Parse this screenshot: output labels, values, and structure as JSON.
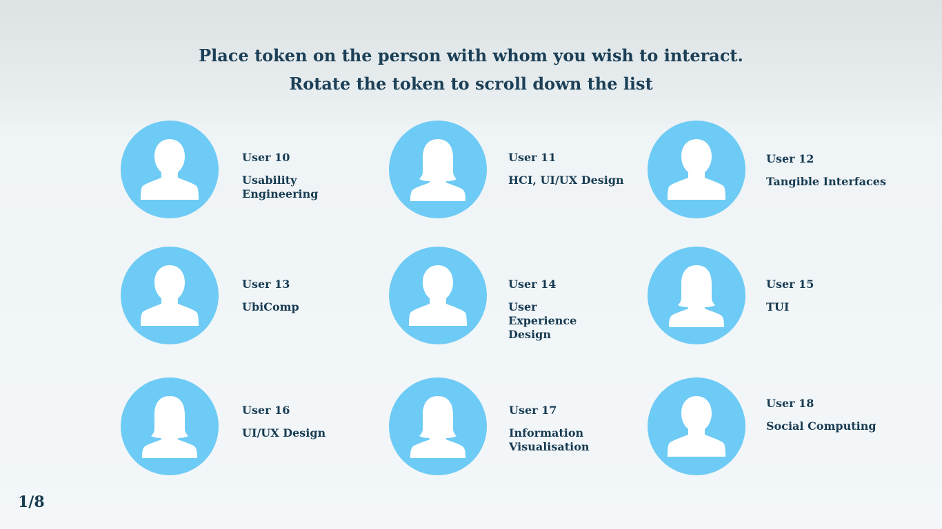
{
  "instructions": {
    "line1": "Place token on the person with whom you wish to interact.",
    "line2": "Rotate the token to scroll down the list"
  },
  "colors": {
    "avatar_circle": "#6ecbf5",
    "avatar_silhouette": "#ffffff",
    "text": "#173b52"
  },
  "users": [
    {
      "name": "User 10",
      "topic": "Usability Engineering",
      "avatar": "male-avatar-icon"
    },
    {
      "name": "User 11",
      "topic": "HCI, UI/UX Design",
      "avatar": "female-avatar-icon"
    },
    {
      "name": "User 12",
      "topic": "Tangible Interfaces",
      "avatar": "male-avatar-icon"
    },
    {
      "name": "User 13",
      "topic": "UbiComp",
      "avatar": "male-avatar-icon"
    },
    {
      "name": "User 14",
      "topic": "User Experience Design",
      "avatar": "male-avatar-icon"
    },
    {
      "name": "User 15",
      "topic": "TUI",
      "avatar": "female-avatar-icon"
    },
    {
      "name": "User 16",
      "topic": "UI/UX Design",
      "avatar": "female-avatar-icon"
    },
    {
      "name": "User 17",
      "topic": "Information Visualisation",
      "avatar": "female-avatar-icon"
    },
    {
      "name": "User 18",
      "topic": "Social Computing",
      "avatar": "male-avatar-icon"
    }
  ],
  "pager": {
    "label": "1/8"
  }
}
